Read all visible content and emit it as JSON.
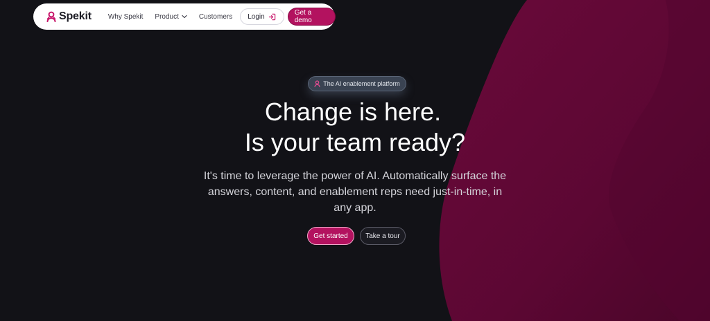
{
  "brand": {
    "name": "Spekit",
    "logo_icon": "spekit-logo-icon"
  },
  "nav": {
    "links": [
      {
        "label": "Why Spekit"
      },
      {
        "label": "Product",
        "icon": "chevron-down-icon"
      },
      {
        "label": "Customers"
      }
    ],
    "login_label": "Login",
    "login_icon": "login-arrow-icon",
    "demo_label": "Get a demo"
  },
  "hero": {
    "badge": "The AI enablement platform",
    "badge_icon": "spekit-logo-icon",
    "headline_line1": "Change is here.",
    "headline_line2": "Is your team ready?",
    "subtext": "It's time to leverage the power of AI. Automatically surface the answers, content, and enablement reps need just-in-time, in any app.",
    "primary_cta": "Get started",
    "secondary_cta": "Take a tour"
  },
  "colors": {
    "background": "#121217",
    "accent": "#b3125f",
    "blob": "#6e0a3a"
  }
}
